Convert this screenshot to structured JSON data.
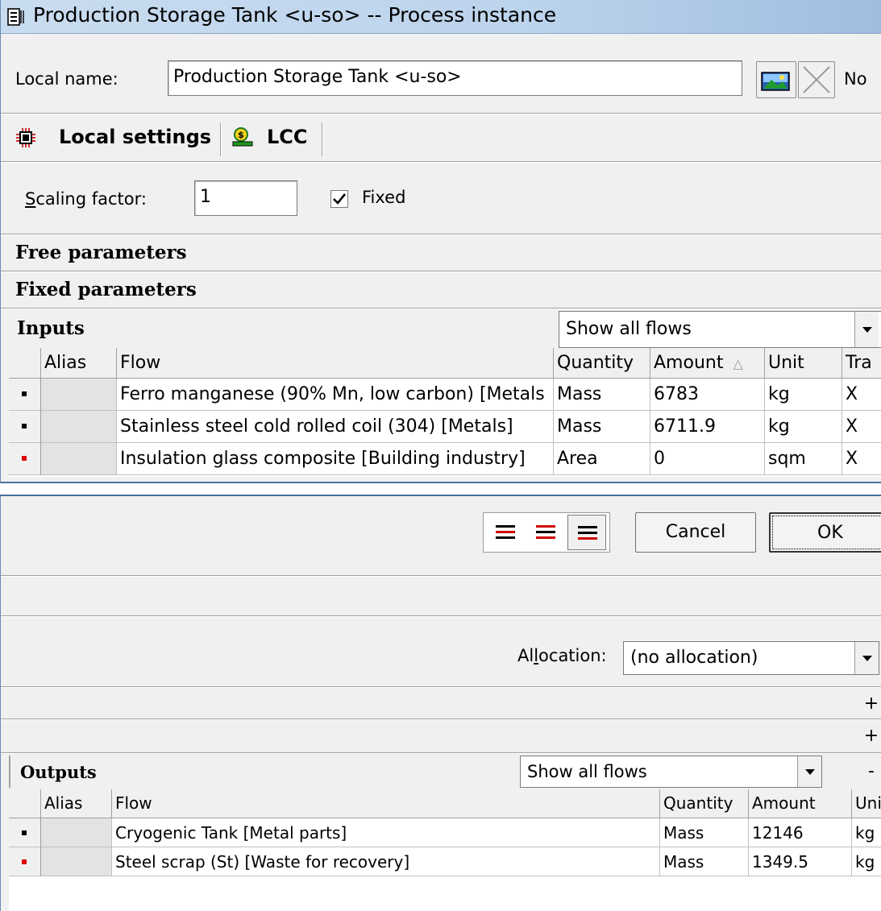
{
  "window": {
    "title": "Production Storage Tank <u-so> -- Process instance"
  },
  "local_name": {
    "label": "Local name:",
    "value": "Production Storage Tank <u-so>",
    "trailing_text": "No"
  },
  "tabs": [
    {
      "label": "Local settings",
      "icon": "circuit-icon"
    },
    {
      "label": "LCC",
      "icon": "lcc-icon"
    }
  ],
  "scaling": {
    "label": "Scaling factor:",
    "value": "1",
    "fixed_label": "Fixed",
    "fixed_checked": true
  },
  "sections": {
    "free_parameters": "Free parameters",
    "fixed_parameters": "Fixed parameters"
  },
  "inputs": {
    "title": "Inputs",
    "filter": "Show all flows",
    "columns": [
      "Alias",
      "Flow",
      "Quantity",
      "Amount",
      "Unit",
      "Tra"
    ],
    "sort_indicator": "△",
    "rows": [
      {
        "flow": "Ferro manganese (90% Mn, low carbon) [Metals",
        "quantity": "Mass",
        "amount": "6783",
        "unit": "kg",
        "tra": "X",
        "marker_color": "#000000"
      },
      {
        "flow": "Stainless steel cold rolled coil (304) [Metals]",
        "quantity": "Mass",
        "amount": "6711.9",
        "unit": "kg",
        "tra": "X",
        "marker_color": "#000000"
      },
      {
        "flow": "Insulation glass composite [Building industry]",
        "quantity": "Area",
        "amount": "0",
        "unit": "sqm",
        "tra": "X",
        "marker_color": "#e00000"
      }
    ]
  },
  "dialog_buttons": {
    "cancel": "Cancel",
    "ok": "OK"
  },
  "allocation": {
    "label": "Allocation:",
    "value": "(no allocation)"
  },
  "side_buttons": [
    "+",
    "+",
    "-"
  ],
  "outputs": {
    "title": "Outputs",
    "filter": "Show all flows",
    "columns": [
      "Alias",
      "Flow",
      "Quantity",
      "Amount",
      "Uni"
    ],
    "rows": [
      {
        "flow": "Cryogenic Tank [Metal parts]",
        "quantity": "Mass",
        "amount": "12146",
        "unit": "kg",
        "marker_color": "#000000"
      },
      {
        "flow": "Steel scrap (St) [Waste for recovery]",
        "quantity": "Mass",
        "amount": "1349.5",
        "unit": "kg",
        "marker_color": "#e00000"
      }
    ]
  },
  "colors": {
    "titlebar": "#bcd3ec",
    "window_bg": "#f0f0f0",
    "alias_cell": "#e3e3e3",
    "accent_red": "#e00000"
  }
}
